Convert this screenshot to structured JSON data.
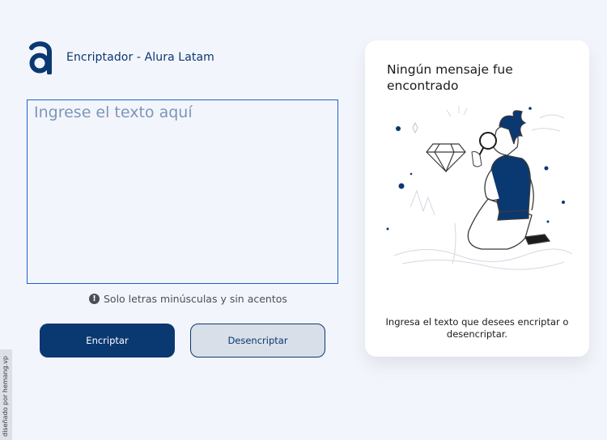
{
  "header": {
    "logo_icon": "alura-logo-icon",
    "title": "Encriptador - Alura Latam"
  },
  "editor": {
    "placeholder": "Ingrese el texto aquí",
    "value": ""
  },
  "hint": {
    "icon": "exclamation-circle-icon",
    "text": "Solo letras minúsculas y sin acentos"
  },
  "buttons": {
    "encrypt_label": "Encriptar",
    "decrypt_label": "Desencriptar"
  },
  "output_panel": {
    "title": "Ningún mensaje fue encontrado",
    "illustration": "person-with-magnifying-glass-illustration",
    "description": "Ingresa el texto que desees encriptar o desencriptar."
  },
  "credit": "diseñado por hemang.vp",
  "colors": {
    "background": "#f3f5fc",
    "primary": "#0a3871",
    "secondary_button": "#d8dfe8",
    "panel": "#ffffff"
  }
}
